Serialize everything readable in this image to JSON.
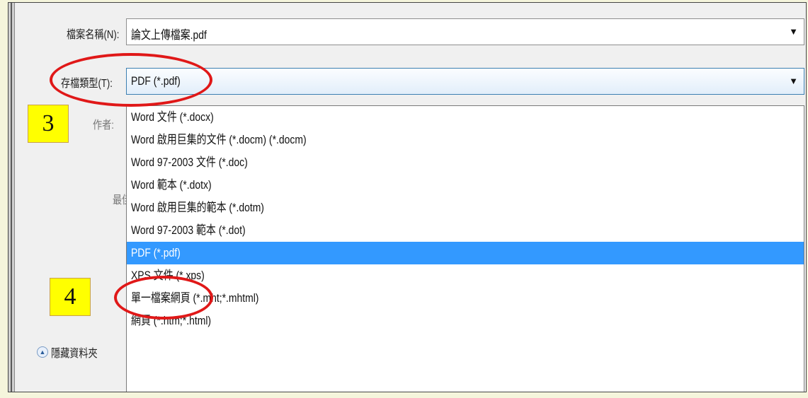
{
  "dialog": {
    "filename_label": "檔案名稱(N):",
    "filename_value": "論文上傳檔案.pdf",
    "type_label": "存檔類型(T):",
    "type_value": "PDF (*.pdf)",
    "author_label_partial": "作者:",
    "partial_label_2": "最佳"
  },
  "dropdown": {
    "options": [
      "Word 文件 (*.docx)",
      "Word 啟用巨集的文件 (*.docm) (*.docm)",
      "Word 97-2003 文件 (*.doc)",
      "Word 範本 (*.dotx)",
      "Word 啟用巨集的範本 (*.dotm)",
      "Word 97-2003 範本 (*.dot)",
      "PDF (*.pdf)",
      "XPS 文件 (*.xps)",
      "單一檔案網頁 (*.mht;*.mhtml)",
      "網頁 (*.htm;*.html)"
    ],
    "selected_index": 6
  },
  "hide_folders_label": "隱藏資料夾",
  "annotations": {
    "step3": "3",
    "step4": "4",
    "ring_color": "#e01818",
    "box_color": "#ffff00"
  },
  "colors": {
    "selection": "#3399ff",
    "page_background": "#f5f5dc"
  },
  "icons": {
    "dropdown_arrow": "chevron-down-icon",
    "hide_folders": "collapse-up-icon"
  }
}
